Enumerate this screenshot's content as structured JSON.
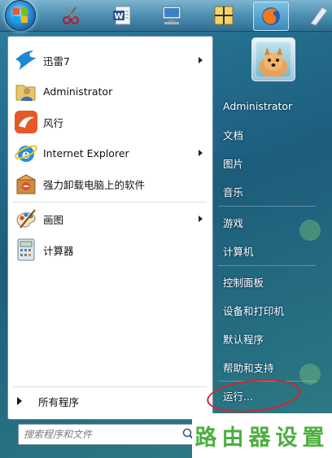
{
  "taskbar": {
    "icons": [
      {
        "name": "start-orb"
      },
      {
        "name": "scissors-tool-icon"
      },
      {
        "name": "word-document-icon"
      },
      {
        "name": "remote-desktop-icon"
      },
      {
        "name": "measure-tool-icon"
      },
      {
        "name": "firefox-icon"
      },
      {
        "name": "shortcut-icon"
      }
    ]
  },
  "left_menu": {
    "items": [
      {
        "label": "迅雷7",
        "icon": "thunder-bird-icon",
        "has_submenu": true
      },
      {
        "label": "Administrator",
        "icon": "user-folder-icon",
        "has_submenu": false
      },
      {
        "label": "风行",
        "icon": "funshion-icon",
        "has_submenu": false
      },
      {
        "label": "Internet Explorer",
        "icon": "internet-explorer-icon",
        "has_submenu": true
      },
      {
        "label": "强力卸载电脑上的软件",
        "icon": "uninstall-box-icon",
        "has_submenu": false
      },
      {
        "label": "画图",
        "icon": "paint-palette-icon",
        "has_submenu": true
      },
      {
        "label": "计算器",
        "icon": "calculator-icon",
        "has_submenu": false
      }
    ],
    "all_programs": "所有程序",
    "search_placeholder": "搜索程序和文件"
  },
  "right_menu": {
    "items": [
      {
        "label": "Administrator"
      },
      {
        "label": "文档"
      },
      {
        "label": "图片"
      },
      {
        "label": "音乐"
      },
      {
        "label": "游戏"
      },
      {
        "label": "计算机"
      },
      {
        "label": "控制面板"
      },
      {
        "label": "设备和打印机"
      },
      {
        "label": "默认程序"
      },
      {
        "label": "帮助和支持"
      },
      {
        "label": "运行..."
      }
    ]
  },
  "annotation": {
    "color": "#d8232a"
  },
  "watermark": "路由器设置",
  "colors": {
    "watermark_green": "#4caf3f",
    "accent_blue": "#1d5d7c"
  }
}
